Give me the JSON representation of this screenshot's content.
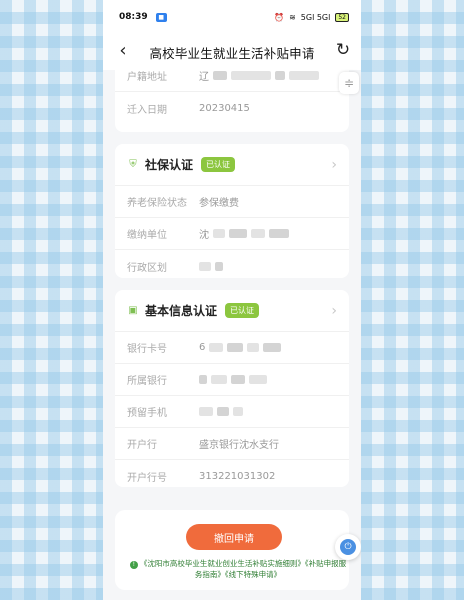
{
  "status_bar": {
    "time": "08:39",
    "signal": "5Gl 5Gl",
    "battery": "52"
  },
  "nav": {
    "title": "高校毕业生就业生活补贴申请",
    "back_icon": "‹",
    "refresh_icon": "↻"
  },
  "top_card": {
    "rows": [
      {
        "label": "户籍地址",
        "value": "辽"
      },
      {
        "label": "迁入日期",
        "value": "20230415"
      }
    ]
  },
  "social_card": {
    "title": "社保认证",
    "badge": "已认证",
    "rows": [
      {
        "label": "养老保险状态",
        "value": "参保缴费"
      },
      {
        "label": "缴纳单位",
        "value": "沈"
      },
      {
        "label": "行政区划",
        "value": ""
      }
    ]
  },
  "basic_card": {
    "title": "基本信息认证",
    "badge": "已认证",
    "rows": [
      {
        "label": "银行卡号",
        "value": "6"
      },
      {
        "label": "所属银行",
        "value": ""
      },
      {
        "label": "预留手机",
        "value": ""
      },
      {
        "label": "开户行",
        "value": "盛京银行沈水支行"
      },
      {
        "label": "开户行号",
        "value": "313221031302"
      }
    ]
  },
  "action": {
    "revoke_label": "撤回申请",
    "links_text": "《沈阳市高校毕业生就业创业生活补贴实施细则》《补贴申报服务指南》《线下特殊申请》"
  },
  "colors": {
    "accent": "#f06b3c",
    "verified": "#8cc63f",
    "link": "#2e7d32"
  }
}
